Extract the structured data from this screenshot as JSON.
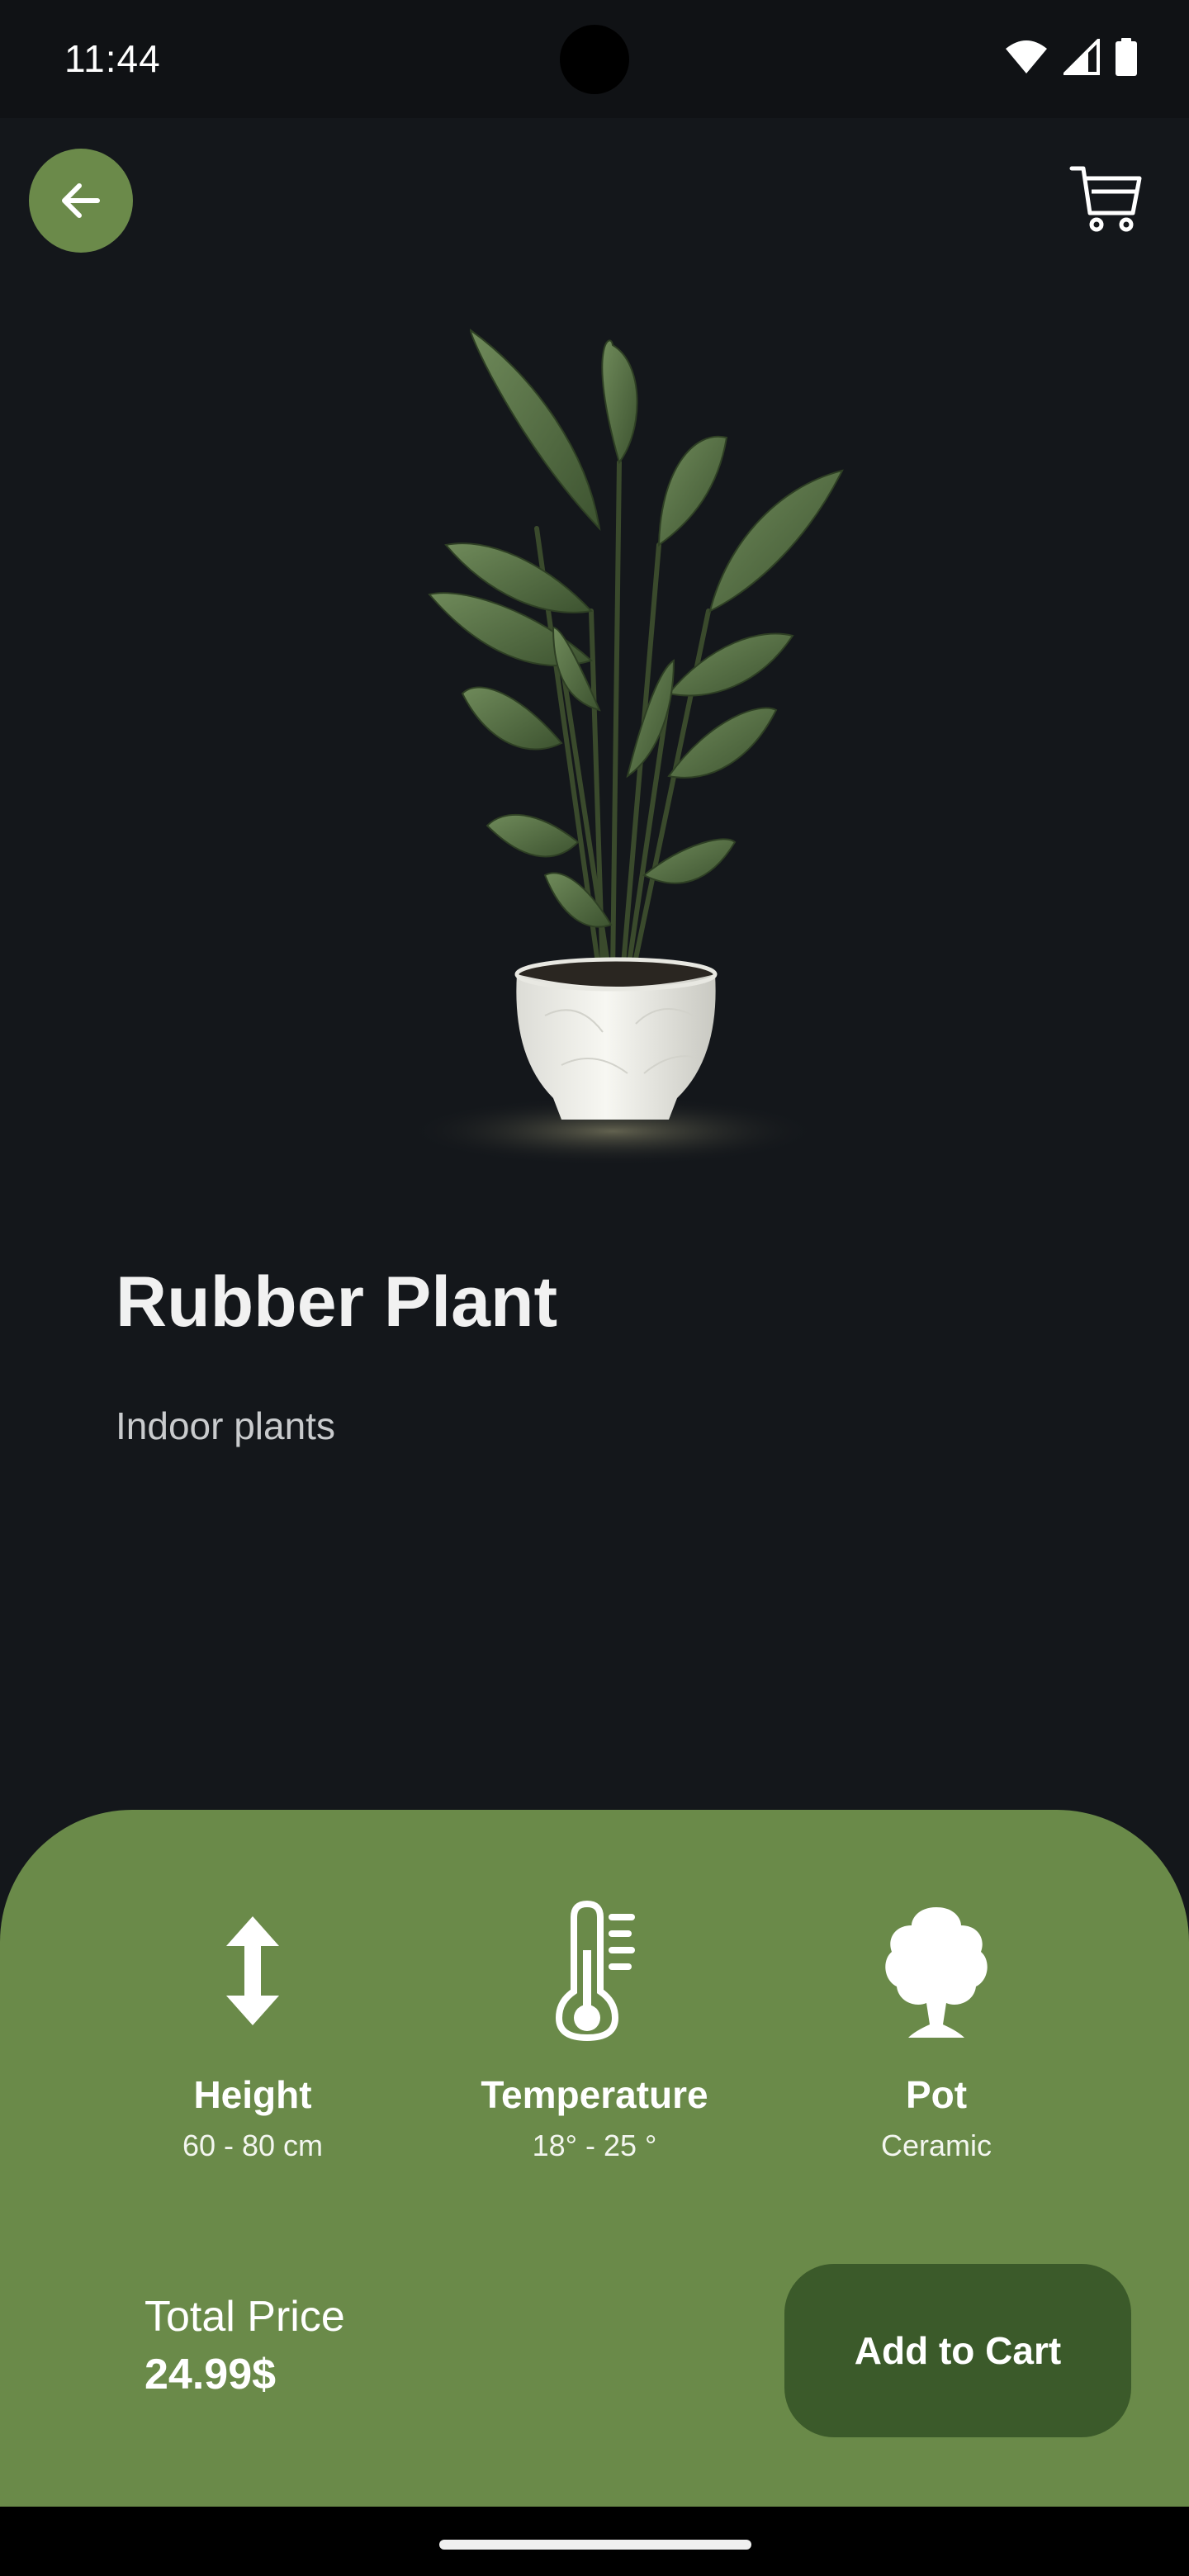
{
  "status_bar": {
    "time": "11:44",
    "icons": [
      "wifi-icon",
      "cell-signal-icon",
      "battery-icon"
    ]
  },
  "header": {
    "back_icon": "arrow-left-icon",
    "cart_icon": "shopping-cart-icon"
  },
  "product": {
    "name": "Rubber Plant",
    "category": "Indoor plants",
    "image_icon": "potted-plant-image"
  },
  "specs": [
    {
      "icon": "height-arrows-icon",
      "label": "Height",
      "value": "60 - 80 cm"
    },
    {
      "icon": "thermometer-icon",
      "label": "Temperature",
      "value": "18° - 25 °"
    },
    {
      "icon": "tree-icon",
      "label": "Pot",
      "value": "Ceramic"
    }
  ],
  "footer": {
    "price_label": "Total Price",
    "price_value": "24.99$",
    "button_label": "Add to Cart"
  },
  "colors": {
    "background": "#14171b",
    "accent_green": "#6a8a49",
    "button_dark_green": "#3b5a2a",
    "text_primary": "#f1f1f1"
  }
}
